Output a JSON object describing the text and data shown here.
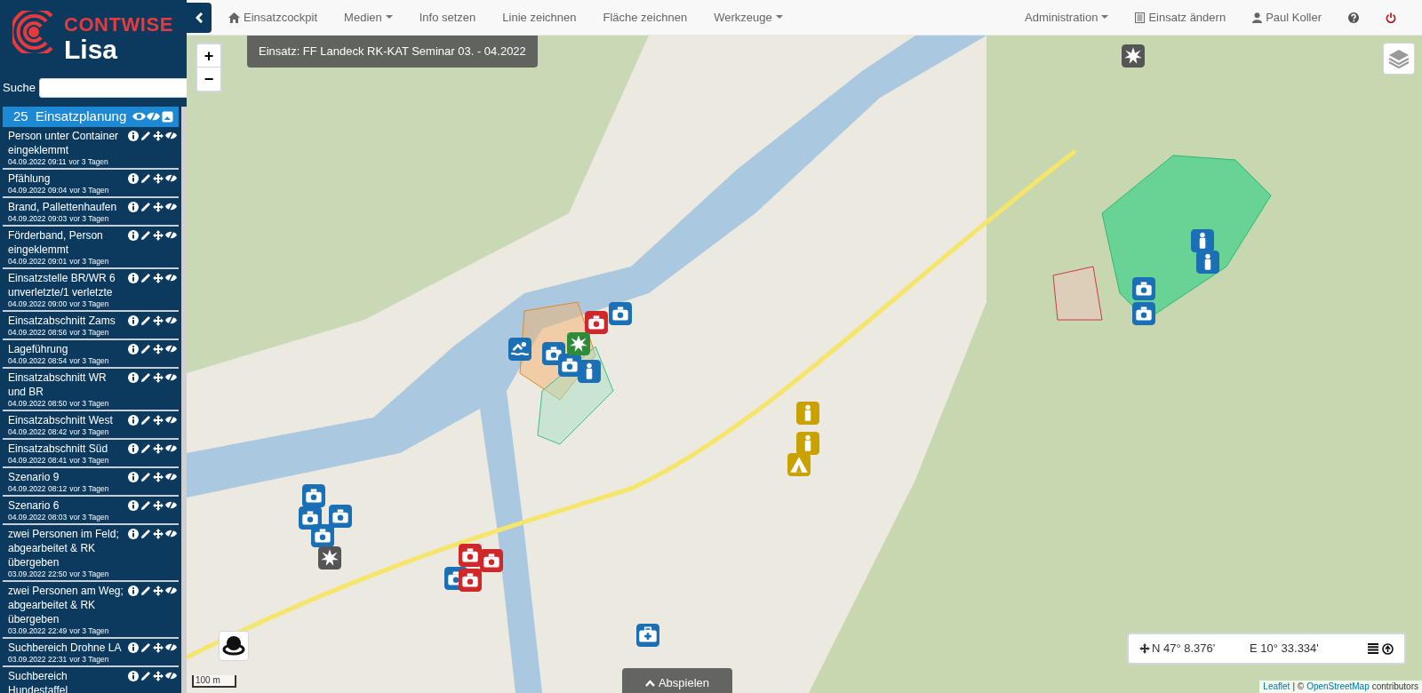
{
  "app": {
    "brand": "CONTWISE",
    "product": "Lisa"
  },
  "search": {
    "label": "Suche"
  },
  "layer": {
    "count": "25",
    "title": "Einsatzplanung"
  },
  "entries": [
    {
      "title": "Person unter Container eingeklemmt",
      "timestamp": "04.09.2022 09:11",
      "age": "vor 3 Tagen"
    },
    {
      "title": "Pfählung",
      "timestamp": "04.09.2022 09:04",
      "age": "vor 3 Tagen"
    },
    {
      "title": "Brand, Pallettenhaufen",
      "timestamp": "04.09.2022 09:03",
      "age": "vor 3 Tagen"
    },
    {
      "title": "Förderband, Person eingeklemmt",
      "timestamp": "04.09.2022 09:01",
      "age": "vor 3 Tagen"
    },
    {
      "title": "Einsatzstelle BR/WR 6 unverletzte/1 verletzte",
      "timestamp": "04.09.2022 09:00",
      "age": "vor 3 Tagen"
    },
    {
      "title": "Einsatzabschnitt Zams",
      "timestamp": "04.09.2022 08:56",
      "age": "vor 3 Tagen"
    },
    {
      "title": "Lageführung",
      "timestamp": "04.09.2022 08:54",
      "age": "vor 3 Tagen"
    },
    {
      "title": "Einsatzabschnitt WR und BR",
      "timestamp": "04.09.2022 08:50",
      "age": "vor 3 Tagen"
    },
    {
      "title": "Einsatzabschnitt West",
      "timestamp": "04.09.2022 08:42",
      "age": "vor 3 Tagen"
    },
    {
      "title": "Einsatzabschnitt Süd",
      "timestamp": "04.09.2022 08:41",
      "age": "vor 3 Tagen"
    },
    {
      "title": "Szenario 9",
      "timestamp": "04.09.2022 08:12",
      "age": "vor 3 Tagen"
    },
    {
      "title": "Szenario 6",
      "timestamp": "04.09.2022 08:03",
      "age": "vor 3 Tagen"
    },
    {
      "title": "zwei Personen im Feld; abgearbeitet & RK übergeben",
      "timestamp": "03.09.2022 22:50",
      "age": "vor 3 Tagen"
    },
    {
      "title": "zwei Personen am Weg; abgearbeitet & RK übergeben",
      "timestamp": "03.09.2022 22:49",
      "age": "vor 3 Tagen"
    },
    {
      "title": "Suchbereich Drohne LA",
      "timestamp": "03.09.2022 22:31",
      "age": "vor 3 Tagen"
    },
    {
      "title": "Suchbereich Hundestaffel"
    }
  ],
  "nav_left": [
    {
      "label": "Einsatzcockpit",
      "kind": "home",
      "dropdown": false
    },
    {
      "label": "Medien",
      "kind": "plain",
      "dropdown": true
    },
    {
      "label": "Info setzen",
      "kind": "plain",
      "dropdown": false
    },
    {
      "label": "Linie zeichnen",
      "kind": "plain",
      "dropdown": false
    },
    {
      "label": "Fläche zeichnen",
      "kind": "plain",
      "dropdown": false
    },
    {
      "label": "Werkzeuge",
      "kind": "plain",
      "dropdown": true
    }
  ],
  "nav_right": [
    {
      "label": "Administration",
      "kind": "plain",
      "dropdown": true
    },
    {
      "label": "Einsatz ändern",
      "kind": "document",
      "dropdown": false
    },
    {
      "label": "Paul Koller",
      "kind": "user",
      "dropdown": false
    },
    {
      "kind": "help"
    },
    {
      "kind": "power"
    }
  ],
  "map": {
    "title": "Einsatz: FF Landeck RK-KAT Seminar 03. - 04.2022",
    "zoom_in": "+",
    "zoom_out": "−",
    "scale": "100 m",
    "north": "N 47° 8.376'",
    "east": "E 10° 33.334'",
    "play_button": "Abspielen",
    "attribution": {
      "leaflet": "Leaflet",
      "separator": "| ©",
      "osm": "OpenStreetMap",
      "suffix": "contributors"
    }
  }
}
